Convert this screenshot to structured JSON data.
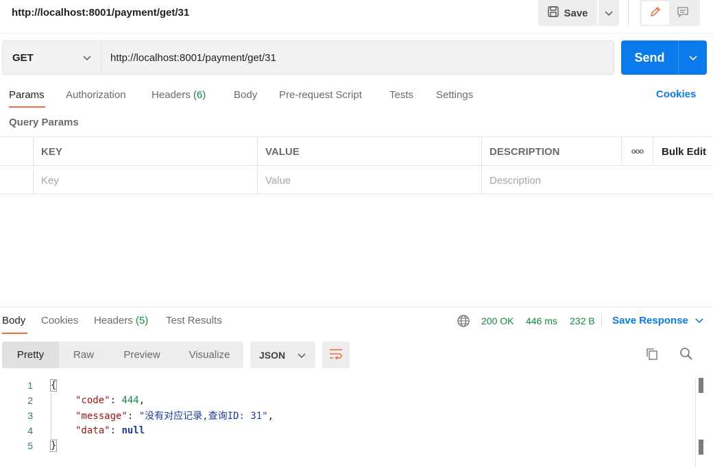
{
  "header": {
    "title": "http://localhost:8001/payment/get/31",
    "save_label": "Save"
  },
  "request": {
    "method": "GET",
    "url": "http://localhost:8001/payment/get/31",
    "send_label": "Send"
  },
  "request_tabs": [
    {
      "label": "Params"
    },
    {
      "label": "Authorization"
    },
    {
      "label": "Headers",
      "count": "(6)"
    },
    {
      "label": "Body"
    },
    {
      "label": "Pre-request Script"
    },
    {
      "label": "Tests"
    },
    {
      "label": "Settings"
    }
  ],
  "cookies_label": "Cookies",
  "query_params": {
    "title": "Query Params",
    "columns": [
      "KEY",
      "VALUE",
      "DESCRIPTION"
    ],
    "more_label": "ooo",
    "bulk_edit": "Bulk Edit",
    "placeholders": {
      "key": "Key",
      "value": "Value",
      "description": "Description"
    }
  },
  "response": {
    "tabs": [
      {
        "label": "Body"
      },
      {
        "label": "Cookies"
      },
      {
        "label": "Headers",
        "count": "(5)"
      },
      {
        "label": "Test Results"
      }
    ],
    "status": "200 OK",
    "time": "446 ms",
    "size": "232 B",
    "save_response": "Save Response",
    "view_modes": [
      "Pretty",
      "Raw",
      "Preview",
      "Visualize"
    ],
    "format": "JSON",
    "code_lines": [
      {
        "n": "1",
        "text": "{"
      },
      {
        "n": "2",
        "key": "\"code\"",
        "sep": ": ",
        "val": "444",
        "end": ","
      },
      {
        "n": "3",
        "key": "\"message\"",
        "sep": ": ",
        "val": "\"没有对应记录,查询ID: 31\"",
        "end": ","
      },
      {
        "n": "4",
        "key": "\"data\"",
        "sep": ": ",
        "val": "null",
        "end": ""
      },
      {
        "n": "5",
        "text": "}"
      }
    ]
  },
  "colors": {
    "accent": "#f26b3a",
    "primary": "#097bed",
    "success": "#0f8a3c"
  }
}
